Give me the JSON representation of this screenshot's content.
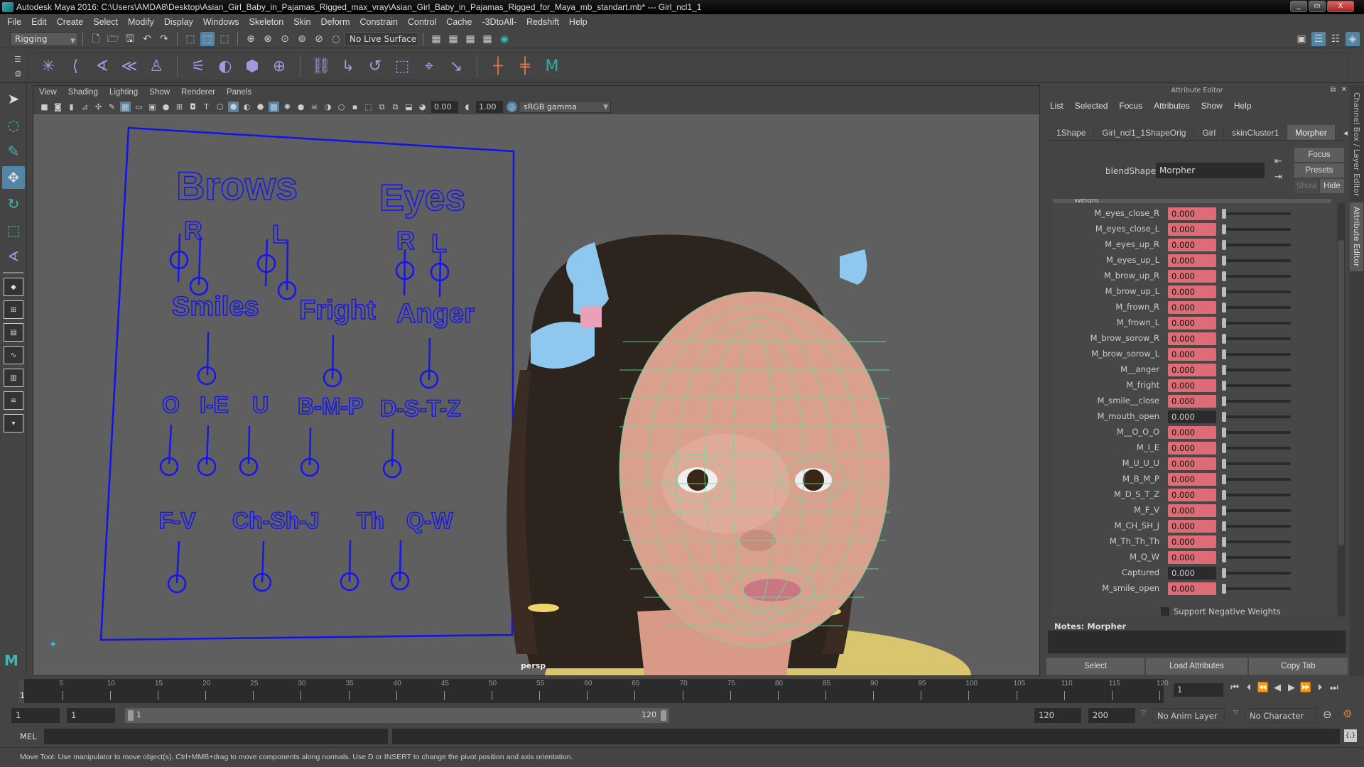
{
  "window": {
    "title": "Autodesk Maya 2016: C:\\Users\\AMDA8\\Desktop\\Asian_Girl_Baby_in_Pajamas_Rigged_max_vray\\Asian_Girl_Baby_in_Pajamas_Rigged_for_Maya_mb_standart.mb*  ---  Girl_ncl1_1",
    "minimize": "_",
    "maximize": "▭",
    "close": "X"
  },
  "menubar": [
    "File",
    "Edit",
    "Create",
    "Select",
    "Modify",
    "Display",
    "Windows",
    "Skeleton",
    "Skin",
    "Deform",
    "Constrain",
    "Control",
    "Cache",
    "-3DtoAll-",
    "Redshift",
    "Help"
  ],
  "statusline": {
    "menuset": "Rigging",
    "live_surface": "No Live Surface"
  },
  "shelf": {
    "icons": [
      "joint-tool-icon",
      "ik-handle-icon",
      "ik-spline-icon",
      "bind-skin-icon",
      "humanik-icon",
      "paint-weights-icon",
      "blend-shape-icon",
      "lattice-icon",
      "cluster-icon",
      "parent-constraint-icon",
      "point-constraint-icon",
      "orient-constraint-icon",
      "scale-constraint-icon",
      "aim-constraint-icon",
      "pole-vector-icon",
      "locator-icon",
      "locator-parent-icon",
      "maya-logo-icon"
    ]
  },
  "toolbox": [
    "select-tool",
    "lasso-tool",
    "paint-select-tool",
    "move-tool",
    "rotate-tool",
    "scale-tool",
    "last-tool"
  ],
  "viewport": {
    "menu": [
      "View",
      "Shading",
      "Lighting",
      "Show",
      "Renderer",
      "Panels"
    ],
    "exposure": "0.00",
    "gamma": "1.00",
    "color_space": "sRGB gamma",
    "camera_label": "persp",
    "faceboard": {
      "headings": [
        "Brows",
        "Eyes",
        "Smiles",
        "Fright",
        "Anger"
      ],
      "side_labels": {
        "brows": [
          "R",
          "L"
        ],
        "eyes": [
          "R",
          "L"
        ]
      },
      "phonemes_row1": [
        "O",
        "I-E",
        "U",
        "B-M-P",
        "D-S-T-Z"
      ],
      "phonemes_row2": [
        "F-V",
        "Ch-Sh-J",
        "Th",
        "Q-W"
      ]
    }
  },
  "attribute_editor": {
    "title": "Attribute Editor",
    "menu": [
      "List",
      "Selected",
      "Focus",
      "Attributes",
      "Show",
      "Help"
    ],
    "tabs": [
      "1Shape",
      "Girl_ncl1_1ShapeOrig",
      "Girl",
      "skinCluster1",
      "Morpher"
    ],
    "active_tab": "Morpher",
    "blendshape_label": "blendShape:",
    "blendshape_value": "Morpher",
    "focus_btn": "Focus",
    "presets_btn": "Presets",
    "show_btn": "Show",
    "hide_btn": "Hide",
    "section": "Weight",
    "weights": [
      {
        "name": "M_eyes_close_R",
        "value": "0.000",
        "keyed": true
      },
      {
        "name": "M_eyes_close_L",
        "value": "0.000",
        "keyed": true
      },
      {
        "name": "M_eyes_up_R",
        "value": "0.000",
        "keyed": true
      },
      {
        "name": "M_eyes_up_L",
        "value": "0.000",
        "keyed": true
      },
      {
        "name": "M_brow_up_R",
        "value": "0.000",
        "keyed": true
      },
      {
        "name": "M_brow_up_L",
        "value": "0.000",
        "keyed": true
      },
      {
        "name": "M_frown_R",
        "value": "0.000",
        "keyed": true
      },
      {
        "name": "M_frown_L",
        "value": "0.000",
        "keyed": true
      },
      {
        "name": "M_brow_sorow_R",
        "value": "0.000",
        "keyed": true
      },
      {
        "name": "M_brow_sorow_L",
        "value": "0.000",
        "keyed": true
      },
      {
        "name": "M__anger",
        "value": "0.000",
        "keyed": true
      },
      {
        "name": "M_fright",
        "value": "0.000",
        "keyed": true
      },
      {
        "name": "M_smile__close",
        "value": "0.000",
        "keyed": true
      },
      {
        "name": "M_mouth_open",
        "value": "0.000",
        "keyed": false
      },
      {
        "name": "M__O_O_O",
        "value": "0.000",
        "keyed": true
      },
      {
        "name": "M_I_E",
        "value": "0.000",
        "keyed": true
      },
      {
        "name": "M_U_U_U",
        "value": "0.000",
        "keyed": true
      },
      {
        "name": "M_B_M_P",
        "value": "0.000",
        "keyed": true
      },
      {
        "name": "M_D_S_T_Z",
        "value": "0.000",
        "keyed": true
      },
      {
        "name": "M_F_V",
        "value": "0.000",
        "keyed": true
      },
      {
        "name": "M_CH_SH_J",
        "value": "0.000",
        "keyed": true
      },
      {
        "name": "M_Th_Th_Th",
        "value": "0.000",
        "keyed": true
      },
      {
        "name": "M_Q_W",
        "value": "0.000",
        "keyed": true
      },
      {
        "name": "Captured",
        "value": "0.000",
        "keyed": false
      },
      {
        "name": "M_smile_open",
        "value": "0.000",
        "keyed": true
      }
    ],
    "slider_fraction": 0,
    "support_negative": "Support Negative Weights",
    "notes_label": "Notes:  Morpher",
    "notes_value": "",
    "select_btn": "Select",
    "load_btn": "Load Attributes",
    "copy_btn": "Copy Tab",
    "side_tabs": [
      "Channel Box / Layer Editor",
      "Attribute Editor"
    ]
  },
  "timeline": {
    "ticks": [
      "5",
      "10",
      "15",
      "20",
      "25",
      "30",
      "35",
      "40",
      "45",
      "50",
      "55",
      "60",
      "65",
      "70",
      "75",
      "80",
      "85",
      "90",
      "95",
      "100",
      "105",
      "110",
      "115",
      "120"
    ],
    "current_frame_marker": "1",
    "current_frame": "1",
    "start": "1",
    "playback_start": "1",
    "range_start": "1",
    "range_end": "120",
    "playback_end": "120",
    "end": "200",
    "anim_layer": "No Anim Layer",
    "character_set": "No Character Set"
  },
  "command": {
    "lang": "MEL",
    "input": "",
    "result": ""
  },
  "help_line": "Move Tool: Use manipulator to move object(s). Ctrl+MMB+drag to move components along normals. Use D or INSERT to change the pivot position and axis orientation."
}
